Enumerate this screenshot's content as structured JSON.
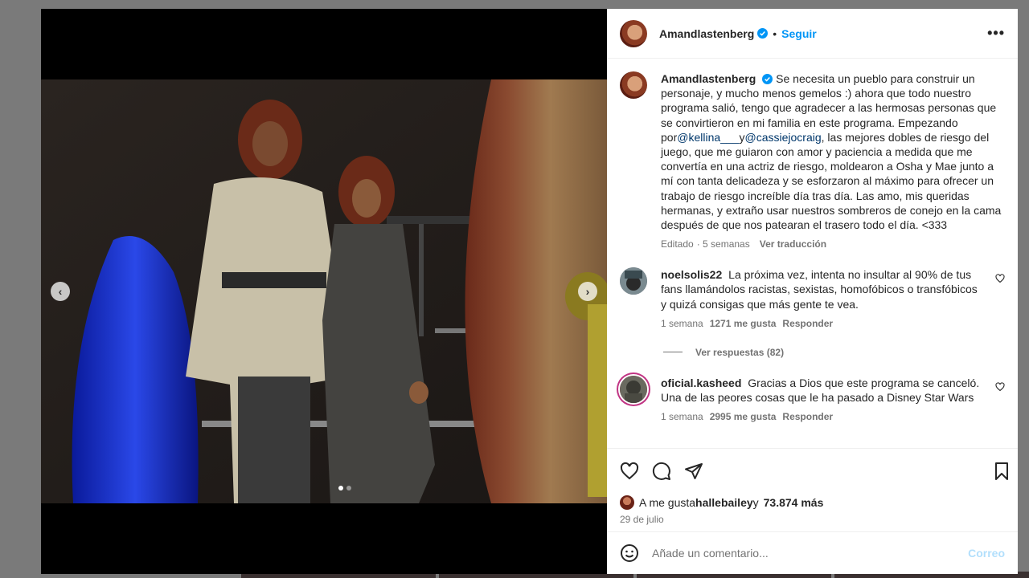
{
  "post": {
    "author": "Amandlastenberg",
    "follow_label": "Seguir",
    "separator": "•",
    "more_label": "•••",
    "caption_prefix": "Se necesita un pueblo para construir un personaje, y mucho menos gemelos :) ahora que todo nuestro programa salió, tengo que agradecer a las hermosas personas que se convirtieron en mi familia en este programa. Empezando por",
    "mention_1": "@kellina___",
    "caption_mid": "y",
    "mention_2": "@cassiejocraig",
    "caption_suffix": ", las mejores dobles de riesgo del juego, que me guiaron con amor y paciencia a medida que me convertía en una actriz de riesgo, moldearon a Osha y Mae junto a mí con tanta delicadeza y se esforzaron al máximo para ofrecer un trabajo de riesgo increíble día tras día. Las amo, mis queridas hermanas, y extraño usar nuestros sombreros de conejo en la cama después de que nos patearan el trasero todo el día. <333",
    "caption_edited": "Editado",
    "caption_time": "· 5 semanas",
    "translate_label": "Ver traducción"
  },
  "comments": [
    {
      "user": "noelsolis22",
      "text": "La próxima vez, intenta no insultar al 90% de tus fans llamándolos racistas, sexistas, homofóbicos o transfóbicos y quizá consigas que más gente te vea.",
      "time": "1 semana",
      "likes": "1271 me gusta",
      "reply": "Responder",
      "view_replies": "Ver respuestas (82)"
    },
    {
      "user": "oficial.kasheed",
      "text": "Gracias a Dios que este programa se canceló. Una de las peores cosas que le ha pasado a Disney Star Wars",
      "time": "1 semana",
      "likes": "2995 me gusta",
      "reply": "Responder"
    }
  ],
  "likes_bar": {
    "prefix": "A me gusta",
    "user": "hallebailey",
    "suffix": "y",
    "count": "73.874 más"
  },
  "date": "29 de julio",
  "comment_box": {
    "placeholder": "Añade un comentario...",
    "post_label": "Correo"
  },
  "media": {
    "prev_label": "‹",
    "next_label": "›",
    "slides": 2,
    "active_slide": 1
  },
  "colors": {
    "accent": "#0095f6",
    "verified": "#0095f6",
    "mention": "#00376b"
  }
}
